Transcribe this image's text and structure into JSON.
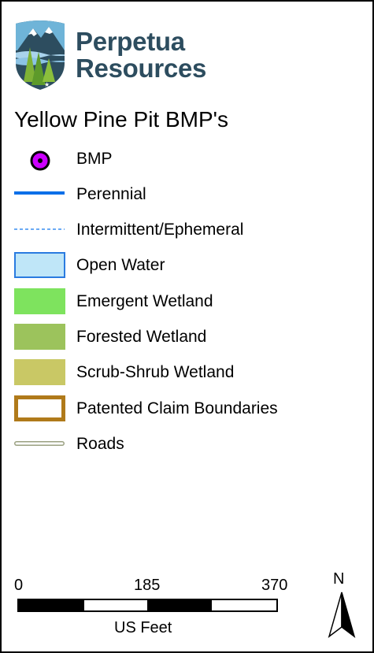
{
  "logo": {
    "line1": "Perpetua",
    "line2": "Resources",
    "brand_color": "#2d4d5f",
    "icon": "mountain-pine-shield-logo"
  },
  "legend": {
    "title": "Yellow Pine Pit BMP's",
    "items": [
      {
        "label": "BMP",
        "symbol": "circle-point",
        "color": "#cc00ff"
      },
      {
        "label": "Perennial",
        "symbol": "solid-line",
        "color": "#0a6fe8"
      },
      {
        "label": "Intermittent/Ephemeral",
        "symbol": "dashed-line",
        "color": "#3a8ef0"
      },
      {
        "label": "Open Water",
        "symbol": "fill-outline",
        "color": "#bfe6f8",
        "outline": "#2a7be0"
      },
      {
        "label": "Emergent Wetland",
        "symbol": "fill",
        "color": "#7ee35e"
      },
      {
        "label": "Forested Wetland",
        "symbol": "fill",
        "color": "#9cc35c"
      },
      {
        "label": "Scrub-Shrub Wetland",
        "symbol": "fill",
        "color": "#c9c865"
      },
      {
        "label": "Patented Claim Boundaries",
        "symbol": "outline-box",
        "color": "#b07a1a"
      },
      {
        "label": "Roads",
        "symbol": "road-line",
        "color": "#c8cdb0"
      }
    ]
  },
  "scale": {
    "labels": [
      "0",
      "185",
      "370"
    ],
    "units": "US Feet"
  },
  "north_arrow": {
    "label": "N",
    "icon": "north-arrow-icon"
  }
}
